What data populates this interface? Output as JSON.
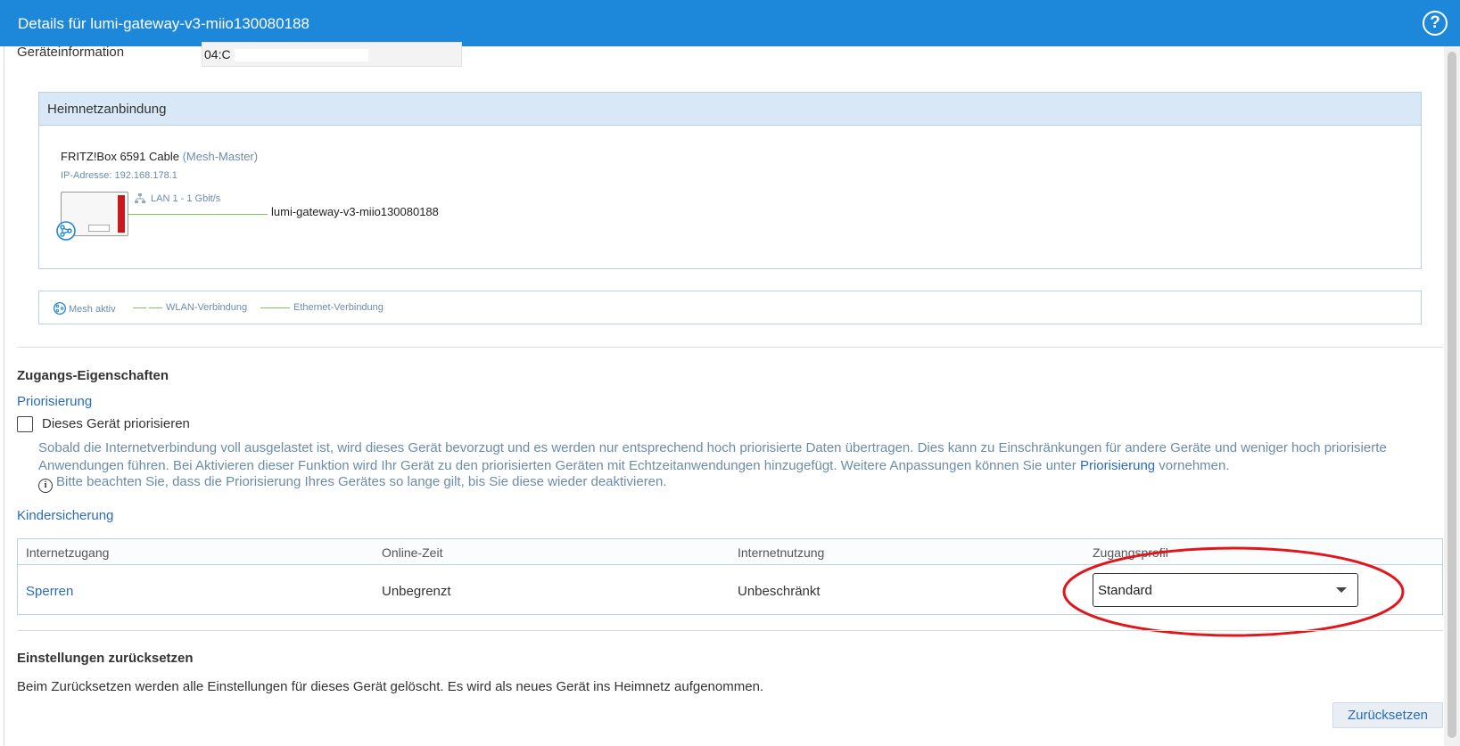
{
  "window": {
    "title": "Details für lumi-gateway-v3-miio130080188",
    "help_label": "?"
  },
  "device_info": {
    "label": "Geräteinformation",
    "value": "04:C"
  },
  "mesh": {
    "header": "Heimnetzanbindung",
    "router_name": "FRITZ!Box 6591 Cable",
    "router_role": "(Mesh-Master)",
    "router_ip": "IP-Adresse: 192.168.178.1",
    "link_label": "LAN 1 - 1 Gbit/s",
    "client_name": "lumi-gateway-v3-miio130080188",
    "line_color": "#7cc65b"
  },
  "legend": {
    "mesh_active": "Mesh aktiv",
    "wlan": "WLAN-Verbindung",
    "ethernet": "Ethernet-Verbindung"
  },
  "access": {
    "heading": "Zugangs-Eigenschaften",
    "prioritization_link": "Priorisierung",
    "checkbox_label": "Dieses Gerät priorisieren",
    "checkbox_checked": false,
    "description_part1": "Sobald die Internetverbindung voll ausgelastet ist, wird dieses Gerät bevorzugt und es werden nur entsprechend hoch priorisierte Daten übertragen. Dies kann zu Einschränkungen für andere Geräte und weniger hoch priorisierte Anwendungen führen. Bei Aktivieren dieser Funktion wird Ihr Gerät zu den priorisierten Geräten mit Echtzeitanwendungen hinzugefügt. Weitere Anpassungen können Sie unter ",
    "description_link": "Priorisierung",
    "description_part2": " vornehmen.",
    "note": "Bitte beachten Sie, dass die Priorisierung Ihres Gerätes so lange gilt, bis Sie diese wieder deaktivieren.",
    "parental_link": "Kindersicherung"
  },
  "parental_table": {
    "headers": [
      "Internetzugang",
      "Online-Zeit",
      "Internetnutzung",
      "Zugangsprofil"
    ],
    "row": {
      "access": "Sperren",
      "online_time": "Unbegrenzt",
      "usage": "Unbeschränkt",
      "profile": "Standard"
    }
  },
  "reset": {
    "heading": "Einstellungen zurücksetzen",
    "text": "Beim Zurücksetzen werden alle Einstellungen für dieses Gerät gelöscht. Es wird als neues Gerät ins Heimnetz aufgenommen.",
    "button": "Zurücksetzen"
  },
  "colors": {
    "titlebar": "#1d87d9",
    "link": "#2a6cb6",
    "muted": "#6b8ca8",
    "annotation": "#e0161b"
  }
}
